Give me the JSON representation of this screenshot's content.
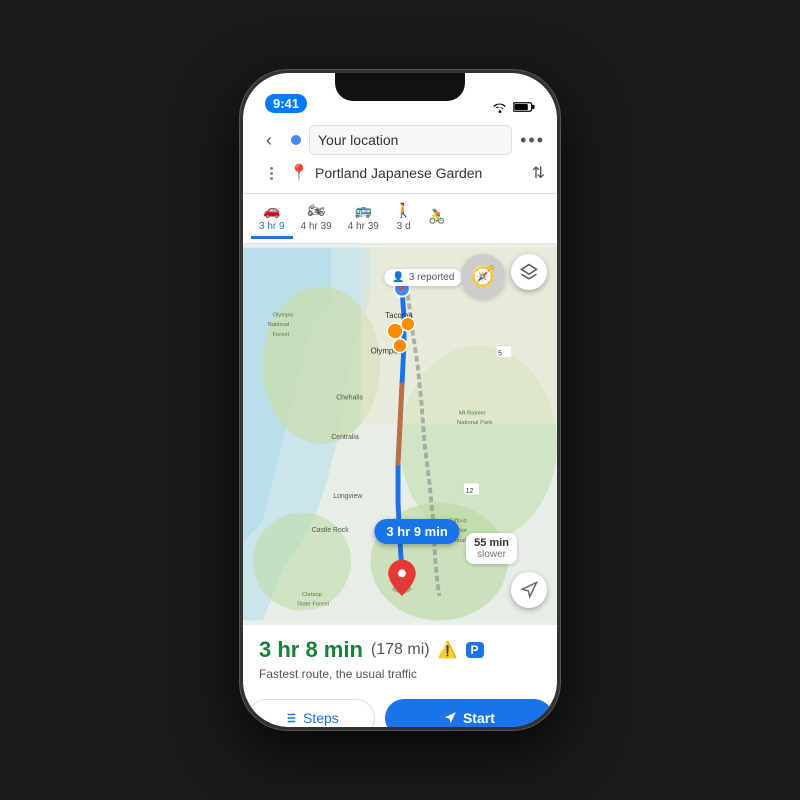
{
  "phone": {
    "status_bar": {
      "time": "9:41",
      "wifi": "wifi",
      "battery": "battery"
    }
  },
  "nav": {
    "back_label": "‹",
    "origin_placeholder": "Your location",
    "origin_value": "Your location",
    "destination_value": "Portland Japanese Garden",
    "more_label": "•••",
    "swap_label": "⇅"
  },
  "tabs": [
    {
      "icon": "🚗",
      "time": "3 hr 9",
      "active": true
    },
    {
      "icon": "🏍",
      "time": "4 hr 39",
      "active": false
    },
    {
      "icon": "🚌",
      "time": "4 hr 39",
      "active": false
    },
    {
      "icon": "🚶",
      "time": "3 d",
      "active": false
    },
    {
      "icon": "🚴",
      "time": "",
      "active": false
    }
  ],
  "map": {
    "reported_text": "3 reported",
    "traffic_slower_line1": "55 min",
    "traffic_slower_line2": "slower",
    "route_time_bubble": "3 hr 9 min",
    "compass_label": ""
  },
  "route": {
    "time": "3 hr 8 min",
    "distance": "(178 mi)",
    "warning": "⚠",
    "parking": "P",
    "description": "Fastest route, the usual traffic",
    "steps_label": "Steps",
    "start_label": "Start"
  },
  "colors": {
    "blue": "#1a73e8",
    "green": "#188038",
    "red": "#E53935",
    "route_blue": "#1A73E8",
    "alt_route": "#888"
  }
}
